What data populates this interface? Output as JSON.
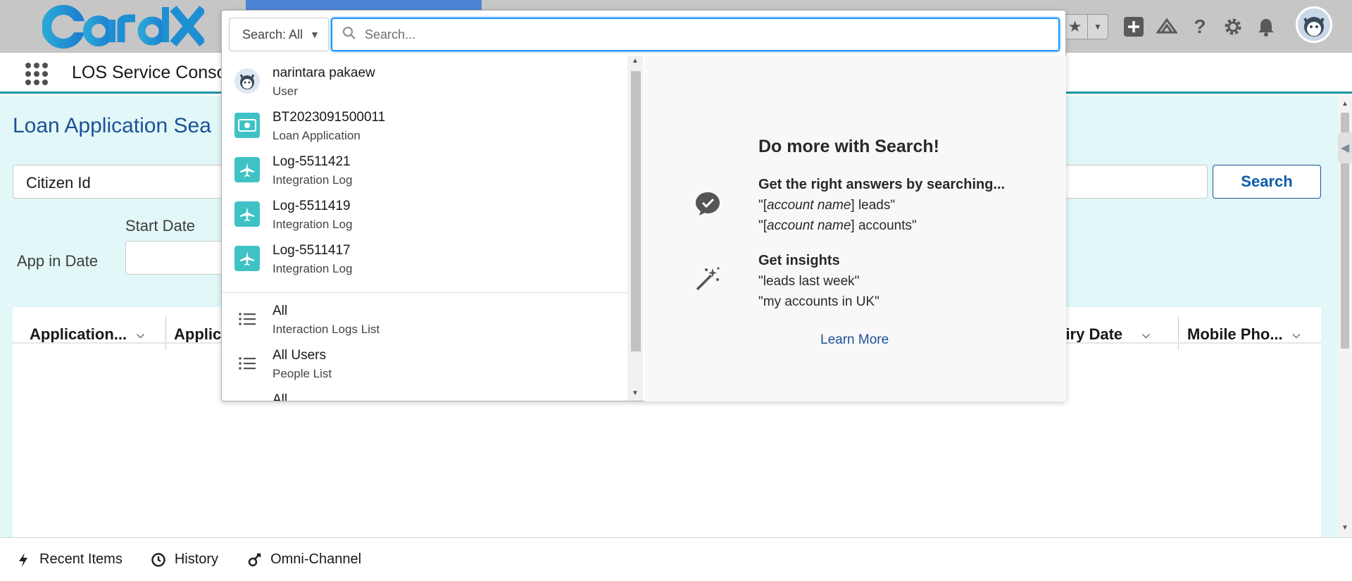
{
  "app": {
    "name": "LOS Service Conso"
  },
  "page": {
    "title": "Loan Application Sea",
    "citizen_field": "Citizen Id",
    "start_date_label": "Start Date",
    "app_in_date_label": "App in Date",
    "search_button": "Search"
  },
  "table": {
    "columns": [
      "Application...",
      "Applic",
      "piry Date",
      "Mobile Pho..."
    ]
  },
  "search": {
    "scope_label": "Search: All",
    "placeholder": "Search...",
    "results": [
      {
        "title": "narintara pakaew",
        "subtitle": "User",
        "icon": "user-avatar-icon"
      },
      {
        "title": "BT2023091500011",
        "subtitle": "Loan Application",
        "icon": "money-icon"
      },
      {
        "title": "Log-5511421",
        "subtitle": "Integration Log",
        "icon": "airplane-icon"
      },
      {
        "title": "Log-5511419",
        "subtitle": "Integration Log",
        "icon": "airplane-icon"
      },
      {
        "title": "Log-5511417",
        "subtitle": "Integration Log",
        "icon": "airplane-icon"
      }
    ],
    "lists": [
      {
        "title": "All",
        "subtitle": "Interaction Logs List",
        "icon": "list-icon"
      },
      {
        "title": "All Users",
        "subtitle": "People List",
        "icon": "list-icon"
      },
      {
        "title": "All",
        "subtitle": "",
        "icon": "list-icon"
      }
    ],
    "tips": {
      "title": "Do more with Search!",
      "answers_heading": "Get the right answers by searching...",
      "answers_line1_prefix": "\"[",
      "answers_line1_em": "account name",
      "answers_line1_suffix": "] leads\"",
      "answers_line2_prefix": "\"[",
      "answers_line2_em": "account name",
      "answers_line2_suffix": "] accounts\"",
      "insights_heading": "Get insights",
      "insights_line1": "\"leads last week\"",
      "insights_line2": "\"my accounts in UK\"",
      "learn_more": "Learn More"
    }
  },
  "utility_bar": {
    "items": [
      {
        "label": "Recent Items",
        "icon": "bolt-icon"
      },
      {
        "label": "History",
        "icon": "clock-icon"
      },
      {
        "label": "Omni-Channel",
        "icon": "omni-channel-icon"
      }
    ]
  },
  "colors": {
    "header_bg": "#c6c6c6",
    "accent_teal": "#1b96a4",
    "content_bg": "#e2f7f7",
    "title_blue": "#1b5297",
    "result_icon_teal": "#3fc2c5",
    "focus_blue": "#1b96ff"
  }
}
